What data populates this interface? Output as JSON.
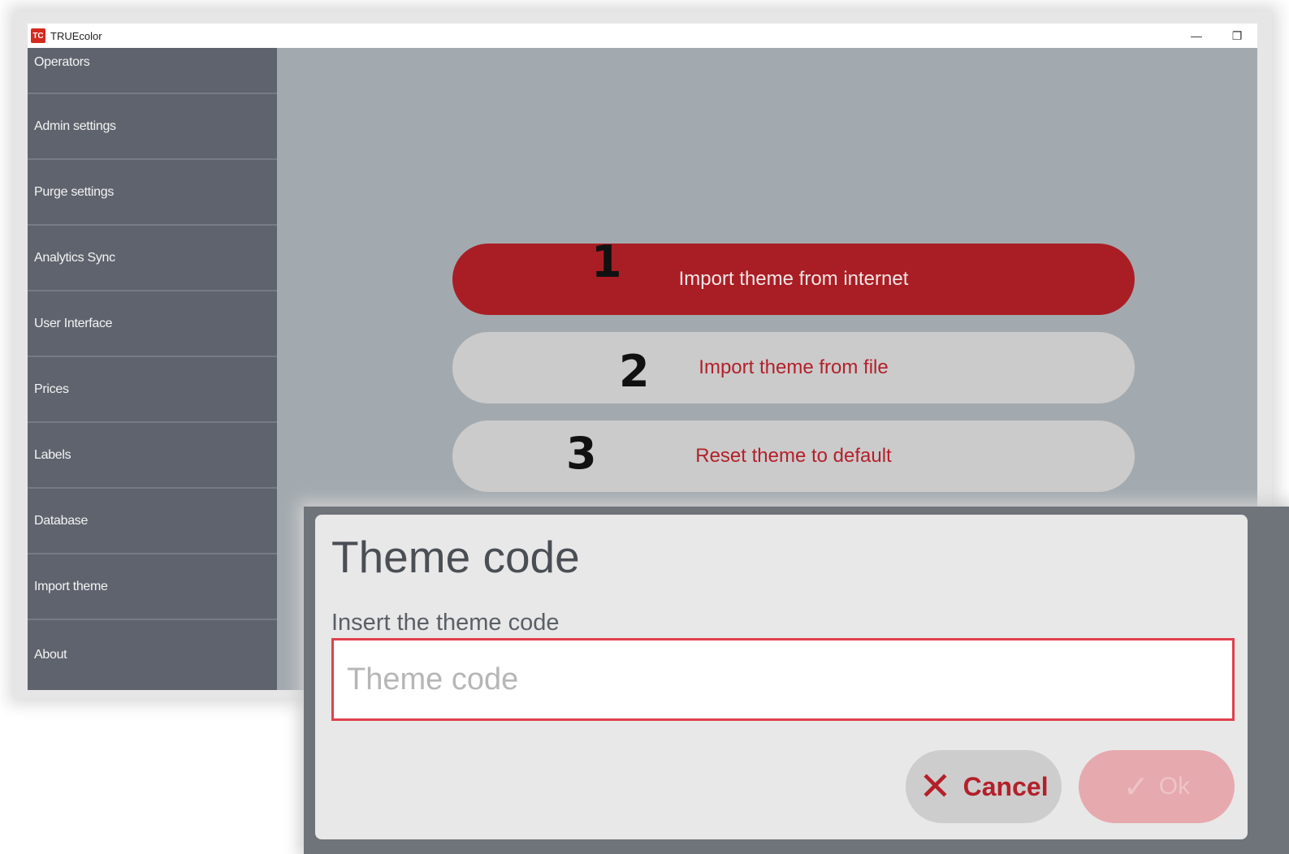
{
  "window": {
    "app_icon_text": "TC",
    "title": "TRUEcolor",
    "minimize_symbol": "—",
    "restore_symbol": "❐"
  },
  "sidebar": {
    "items": [
      {
        "label": "Operators"
      },
      {
        "label": "Admin settings"
      },
      {
        "label": "Purge settings"
      },
      {
        "label": "Analytics Sync"
      },
      {
        "label": "User Interface"
      },
      {
        "label": "Prices"
      },
      {
        "label": "Labels"
      },
      {
        "label": "Database"
      },
      {
        "label": "Import theme"
      },
      {
        "label": "About"
      }
    ]
  },
  "main": {
    "buttons": [
      {
        "label": "Import theme from internet",
        "step": "1",
        "style": "primary"
      },
      {
        "label": "Import theme from file",
        "step": "2",
        "style": "secondary"
      },
      {
        "label": "Reset theme to default",
        "step": "3",
        "style": "secondary"
      }
    ]
  },
  "dialog": {
    "title": "Theme code",
    "field_label": "Insert the theme code",
    "input_value": "",
    "input_placeholder": "Theme code",
    "cancel_icon": "✕",
    "cancel_label": "Cancel",
    "ok_icon": "✓",
    "ok_label": "Ok"
  },
  "colors": {
    "accent_red": "#a91e25",
    "sidebar_bg": "#5e636d",
    "content_bg": "#a3aaaf",
    "input_border": "#e0414d"
  }
}
